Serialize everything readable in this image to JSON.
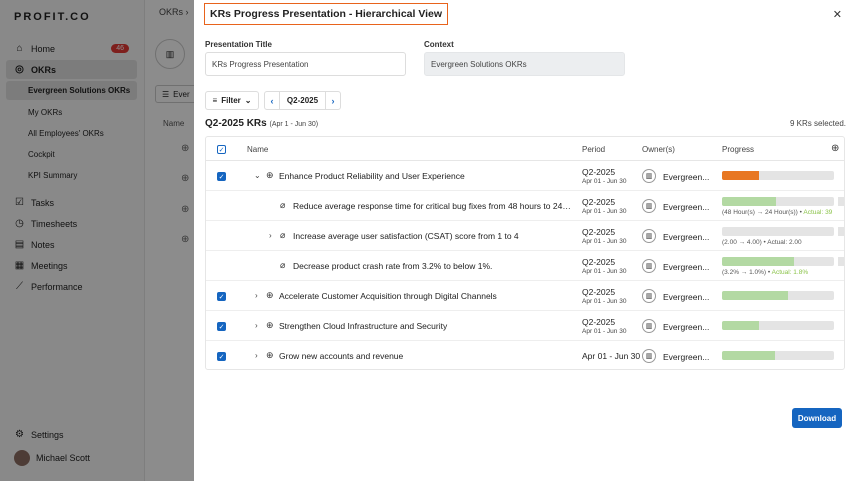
{
  "sidebar": {
    "logo": "PROFIT.CO",
    "home": {
      "label": "Home",
      "badge": "46"
    },
    "okrs": {
      "label": "OKRs"
    },
    "okr_subitems": [
      "Evergreen Solutions OKRs",
      "My OKRs",
      "All Employees' OKRs",
      "Cockpit",
      "KPI Summary"
    ],
    "items": [
      "Tasks",
      "Timesheets",
      "Notes",
      "Meetings",
      "Performance"
    ],
    "settings": "Settings",
    "user": "Michael Scott"
  },
  "background": {
    "breadcrumb": "OKRs",
    "button": "Ever",
    "name_header": "Name"
  },
  "modal": {
    "title": "KRs Progress Presentation - Hierarchical View",
    "presentation_title_label": "Presentation Title",
    "presentation_title_value": "KRs Progress Presentation",
    "context_label": "Context",
    "context_value": "Evergreen Solutions OKRs",
    "filter_label": "Filter",
    "period_value": "Q2-2025",
    "section_title": "Q2-2025 KRs",
    "section_range": "(Apr 1 - Jun 30)",
    "selected_count": "9 KRs selected.",
    "columns": {
      "name": "Name",
      "period": "Period",
      "owners": "Owner(s)",
      "progress": "Progress"
    },
    "rows": [
      {
        "name": "Enhance Product Reliability and User Experience",
        "period": "Q2-2025",
        "period_sub": "Apr 01 - Jun 30",
        "owner": "Evergreen...",
        "progress": 0.33,
        "color": "#e87722",
        "checked": true,
        "chevron": "down",
        "level": 0,
        "sub": ""
      },
      {
        "name": "Reduce average response time for critical bug fixes from 48 hours to 24 ho...",
        "period": "Q2-2025",
        "period_sub": "Apr 01 - Jun 30",
        "owner": "Evergreen...",
        "progress": 0.48,
        "color": "#b3d9a3",
        "checked": false,
        "chevron": "",
        "level": 1,
        "sub": "(48 Hour(s) → 24 Hour(s))",
        "actual": "Actual: 39"
      },
      {
        "name": "Increase average user satisfaction (CSAT) score from 1 to 4",
        "period": "Q2-2025",
        "period_sub": "Apr 01 - Jun 30",
        "owner": "Evergreen...",
        "progress": 0.0,
        "color": "#b3d9a3",
        "checked": false,
        "chevron": "right",
        "level": 1,
        "sub": "(2.00 → 4.00) • Actual: 2.00",
        "actual": ""
      },
      {
        "name": "Decrease product crash rate from 3.2% to below 1%.",
        "period": "Q2-2025",
        "period_sub": "Apr 01 - Jun 30",
        "owner": "Evergreen...",
        "progress": 0.64,
        "color": "#b3d9a3",
        "checked": false,
        "chevron": "",
        "level": 1,
        "sub": "(3.2% → 1.0%)",
        "actual": "Actual: 1.8%"
      },
      {
        "name": "Accelerate Customer Acquisition through Digital Channels",
        "period": "Q2-2025",
        "period_sub": "Apr 01 - Jun 30",
        "owner": "Evergreen...",
        "progress": 0.59,
        "color": "#b3d9a3",
        "checked": true,
        "chevron": "right",
        "level": 0,
        "sub": ""
      },
      {
        "name": "Strengthen Cloud Infrastructure and Security",
        "period": "Q2-2025",
        "period_sub": "Apr 01 - Jun 30",
        "owner": "Evergreen...",
        "progress": 0.33,
        "color": "#b3d9a3",
        "checked": true,
        "chevron": "right",
        "level": 0,
        "sub": ""
      },
      {
        "name": "Grow new accounts and revenue",
        "period": "Apr 01 - Jun 30",
        "period_sub": "",
        "owner": "Evergreen...",
        "progress": 0.47,
        "color": "#b3d9a3",
        "checked": true,
        "chevron": "right",
        "level": 0,
        "sub": ""
      }
    ],
    "download_label": "Download"
  }
}
